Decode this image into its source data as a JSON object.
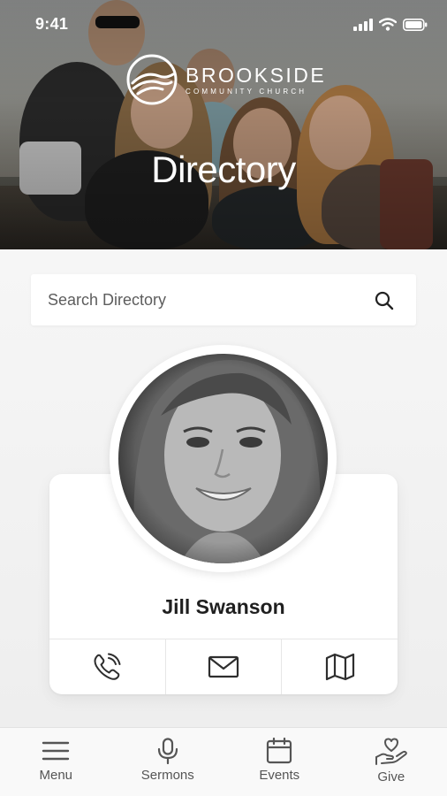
{
  "status_bar": {
    "time": "9:41"
  },
  "hero": {
    "brand_name": "BROOKSIDE",
    "brand_subtitle": "COMMUNITY CHURCH",
    "title": "Directory"
  },
  "search": {
    "placeholder": "Search Directory",
    "value": ""
  },
  "profile": {
    "name": "Jill Swanson",
    "actions": [
      {
        "icon": "phone-icon"
      },
      {
        "icon": "mail-icon"
      },
      {
        "icon": "map-icon"
      }
    ]
  },
  "tabbar": {
    "items": [
      {
        "label": "Menu",
        "icon": "menu-icon"
      },
      {
        "label": "Sermons",
        "icon": "microphone-icon"
      },
      {
        "label": "Events",
        "icon": "calendar-icon"
      },
      {
        "label": "Give",
        "icon": "give-heart-icon"
      }
    ]
  },
  "colors": {
    "icon_stroke": "#3a3a3a",
    "background": "#efefef",
    "card": "#ffffff"
  }
}
